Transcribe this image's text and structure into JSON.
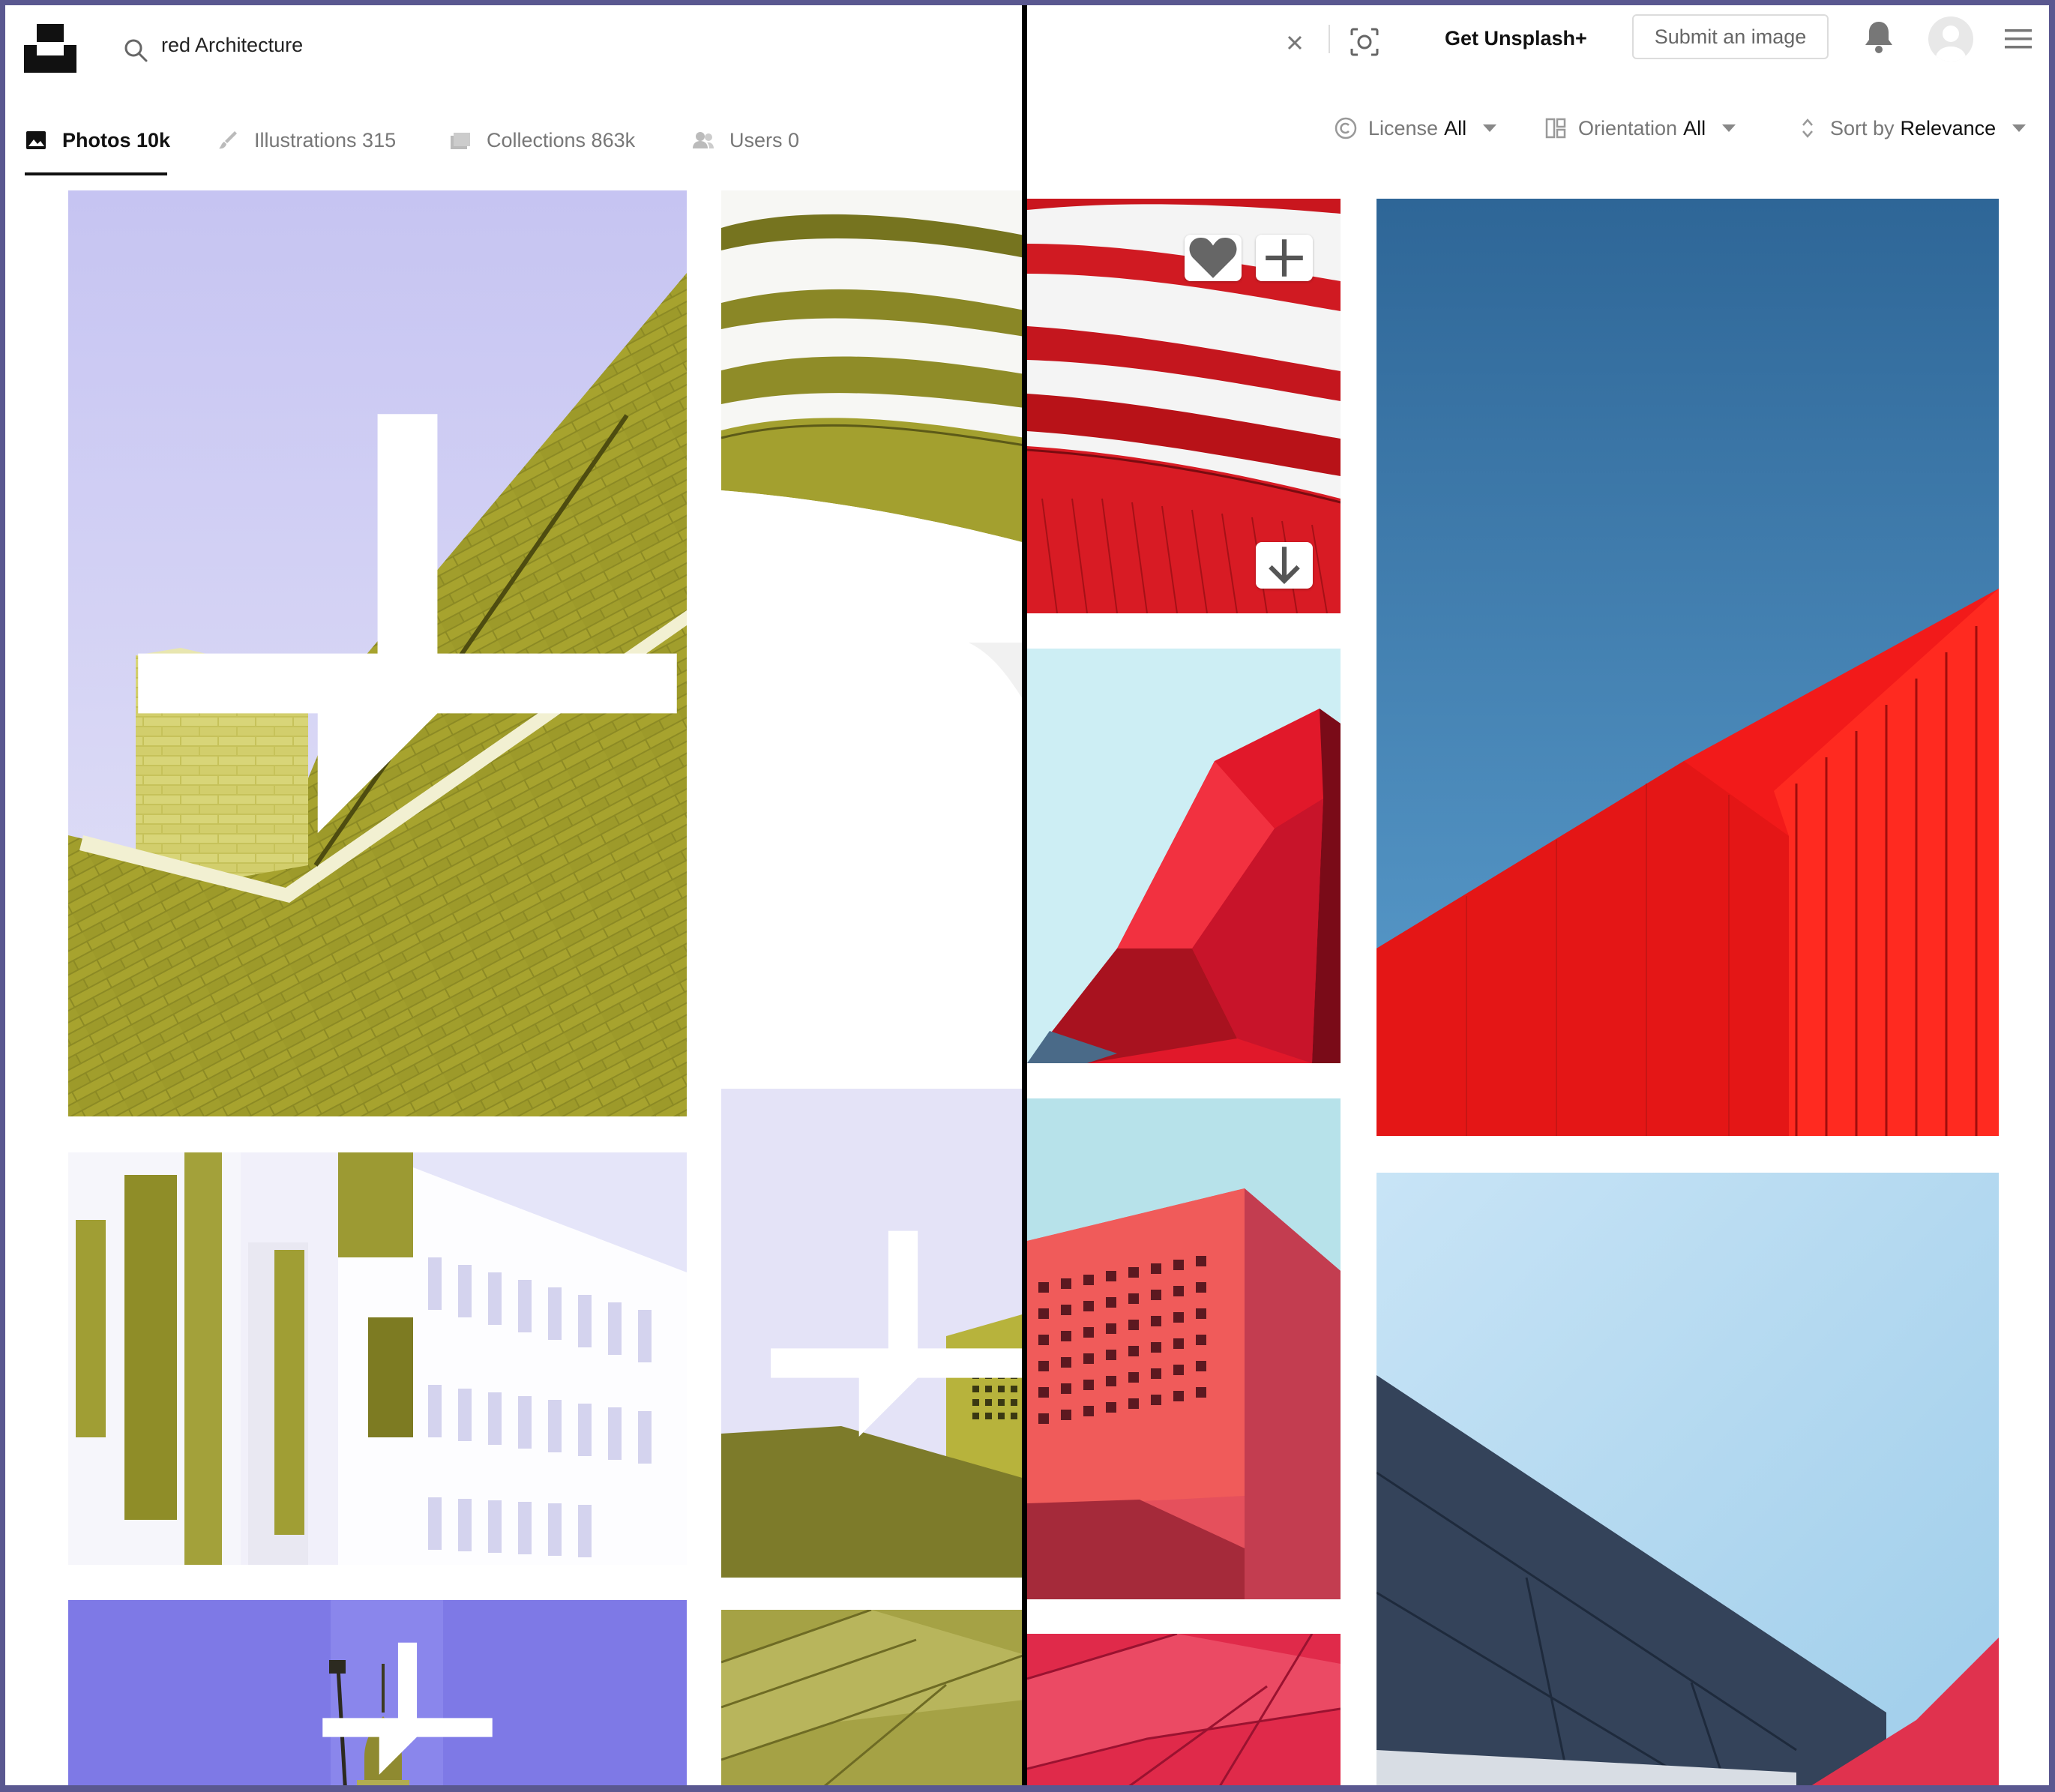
{
  "search": {
    "query": "red Architecture"
  },
  "header": {
    "get_plus_label": "Get Unsplash+",
    "submit_label": "Submit an image"
  },
  "tabs": [
    {
      "label": "Photos 10k",
      "icon": "photo-icon"
    },
    {
      "label": "Illustrations 315",
      "icon": "brush-icon"
    },
    {
      "label": "Collections 863k",
      "icon": "folder-icon"
    },
    {
      "label": "Users 0",
      "icon": "users-icon"
    }
  ],
  "filters": [
    {
      "label": "License",
      "value": "All",
      "icon": "copyright-icon"
    },
    {
      "label": "Orientation",
      "value": "All",
      "icon": "layout-icon"
    },
    {
      "label": "Sort by",
      "value": "Relevance",
      "icon": "sort-icon"
    }
  ],
  "colors": {
    "frame_border": "#5a5890",
    "text_primary": "#111111",
    "text_secondary": "#777777",
    "olive_tint": "#b9b43a",
    "red": "#ef1c1c",
    "sky_blue": "#3f7bb0"
  },
  "icons": [
    "unsplash-logo",
    "search-icon",
    "close-icon",
    "visual-search-icon",
    "bell-icon",
    "menu-icon",
    "heart-icon",
    "add-icon",
    "download-icon",
    "unsplash-plus-icon"
  ]
}
